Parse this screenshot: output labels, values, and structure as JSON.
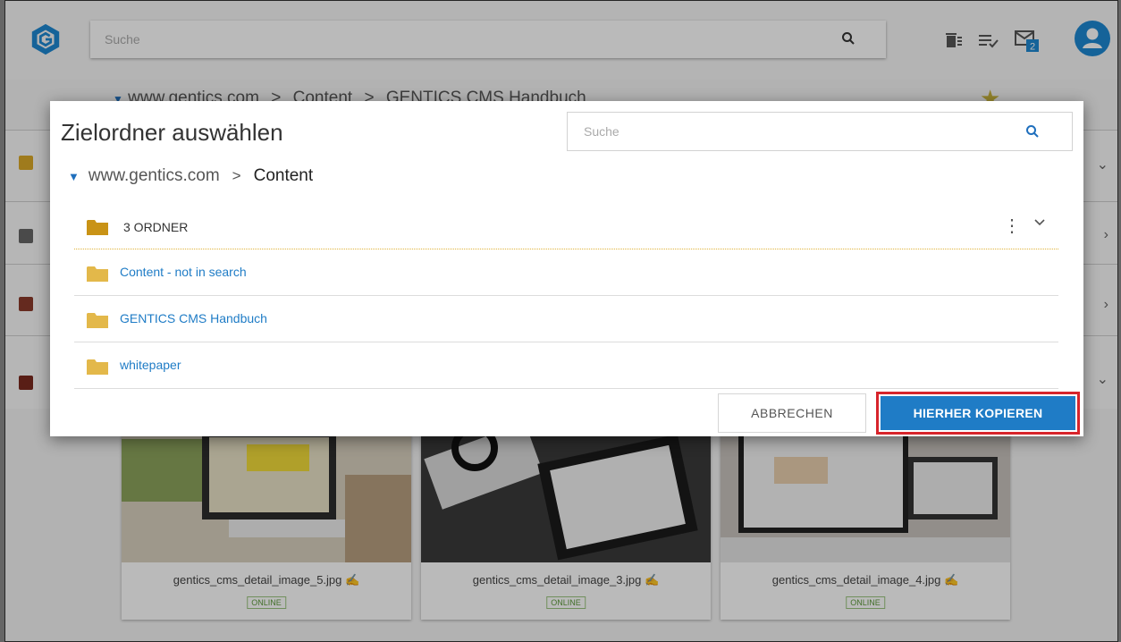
{
  "header": {
    "search_placeholder": "Suche",
    "icons": [
      "gentics-logo-icon",
      "search-icon",
      "wastebin-icon",
      "task-list-icon",
      "messages-icon",
      "user-avatar-icon"
    ],
    "message_count": "2"
  },
  "background": {
    "breadcrumb": {
      "items": [
        "www.gentics.com",
        "Content",
        "GENTICS CMS Handbuch"
      ],
      "separator": ">"
    },
    "images": [
      {
        "filename": "gentics_cms_detail_image_5.jpg",
        "status": "ONLINE"
      },
      {
        "filename": "gentics_cms_detail_image_3.jpg",
        "status": "ONLINE"
      },
      {
        "filename": "gentics_cms_detail_image_4.jpg",
        "status": "ONLINE"
      }
    ]
  },
  "dialog": {
    "title": "Zielordner auswählen",
    "search_placeholder": "Suche",
    "breadcrumb": {
      "root": "www.gentics.com",
      "separator": ">",
      "current": "Content"
    },
    "folder_section": {
      "count_label": "3 ORDNER",
      "folders": [
        {
          "label": "Content - not in search"
        },
        {
          "label": "GENTICS CMS Handbuch"
        },
        {
          "label": "whitepaper"
        }
      ]
    },
    "cancel_label": "ABBRECHEN",
    "confirm_label": "HIERHER KOPIEREN"
  },
  "colors": {
    "primary": "#1f7cc6",
    "folder": "#dba928",
    "highlight": "#d7242b",
    "online": "#5c9a3a"
  }
}
